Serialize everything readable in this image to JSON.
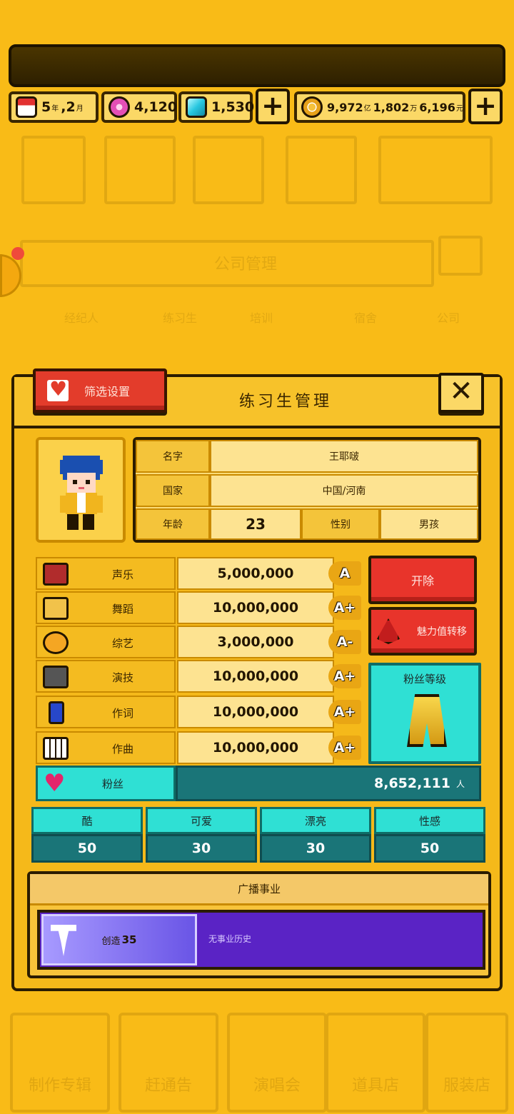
{
  "resources": {
    "date": {
      "year": "5",
      "year_unit": "年",
      "month": ",2",
      "month_unit": "月"
    },
    "pink_gems": "4,120",
    "blue_gems": "1,530",
    "money": {
      "yi": "9,972",
      "yi_unit": "亿",
      "wan": "1,802",
      "wan_unit": "万",
      "yuan": "6,196",
      "yuan_unit": "元"
    },
    "plus_label": "+"
  },
  "background": {
    "panel_title": "公司管理",
    "tabs": [
      "经纪人",
      "练习生",
      "培训",
      "宿舍",
      "公司"
    ],
    "bottom_tabs": [
      "制作专辑",
      "赶通告",
      "演唱会",
      "道具店",
      "服装店"
    ]
  },
  "modal": {
    "select_button": "筛选设置",
    "title": "练习生管理",
    "close_label": "✕",
    "profile": {
      "name_label": "名字",
      "name_value": "王耶啵",
      "country_label": "国家",
      "country_value": "中国/河南",
      "age_label": "年龄",
      "age_value": "23",
      "gender_label": "性别",
      "gender_value": "男孩"
    },
    "stats": [
      {
        "name": "声乐",
        "value": "5,000,000",
        "grade": "A",
        "icon": "microphone-icon"
      },
      {
        "name": "舞蹈",
        "value": "10,000,000",
        "grade": "A+",
        "icon": "boot-icon"
      },
      {
        "name": "综艺",
        "value": "3,000,000",
        "grade": "A-",
        "icon": "mask-icon"
      },
      {
        "name": "演技",
        "value": "10,000,000",
        "grade": "A+",
        "icon": "camera-icon"
      },
      {
        "name": "作词",
        "value": "10,000,000",
        "grade": "A+",
        "icon": "pencil-icon"
      },
      {
        "name": "作曲",
        "value": "10,000,000",
        "grade": "A+",
        "icon": "piano-icon"
      }
    ],
    "dismiss_button": "开除",
    "charm_button": "魅力值转移",
    "fan_level_label": "粉丝等级",
    "fans": {
      "label": "粉丝",
      "value": "8,652,111",
      "unit": "人"
    },
    "attributes": [
      {
        "label": "酷",
        "value": "50"
      },
      {
        "label": "可爱",
        "value": "30"
      },
      {
        "label": "漂亮",
        "value": "30"
      },
      {
        "label": "性感",
        "value": "50"
      }
    ],
    "broadcast": {
      "title": "广播事业",
      "create_label": "创造",
      "create_value": "35",
      "no_history": "无事业历史"
    }
  },
  "colors": {
    "background": "#f9bb17",
    "red_button": "#e8342b",
    "teal": "#2fe0d4",
    "dark_teal": "#1a7578",
    "purple": "#5a23c5"
  }
}
